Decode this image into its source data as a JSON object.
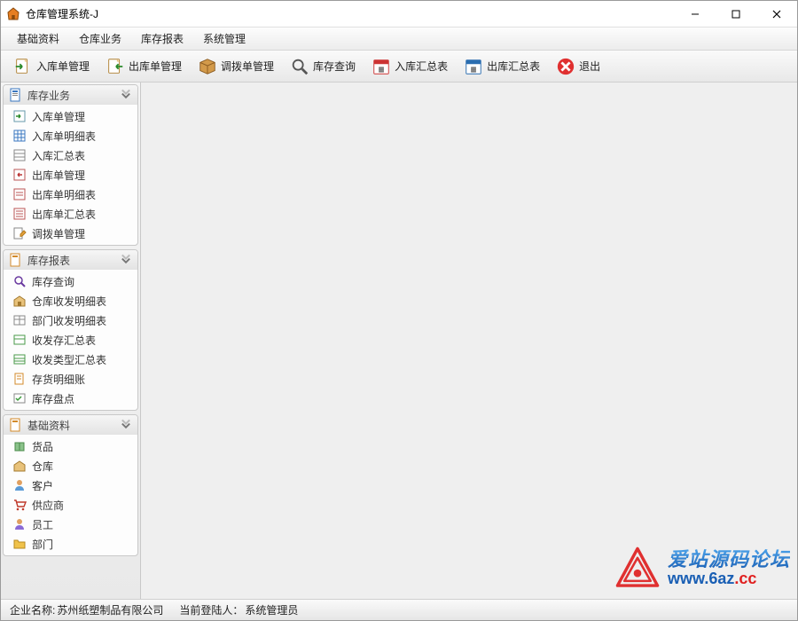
{
  "title": "仓库管理系统-J",
  "menu": [
    "基础资料",
    "仓库业务",
    "库存报表",
    "系统管理"
  ],
  "toolbar": [
    {
      "label": "入库单管理",
      "icon": "doc-arrow-in"
    },
    {
      "label": "出库单管理",
      "icon": "doc-arrow-out"
    },
    {
      "label": "调拨单管理",
      "icon": "box"
    },
    {
      "label": "库存查询",
      "icon": "magnifier"
    },
    {
      "label": "入库汇总表",
      "icon": "calendar"
    },
    {
      "label": "出库汇总表",
      "icon": "calendar"
    },
    {
      "label": "退出",
      "icon": "exit"
    }
  ],
  "panels": [
    {
      "title": "库存业务",
      "icon": "doc-blue",
      "items": [
        {
          "label": "入库单管理",
          "icon": "form-in"
        },
        {
          "label": "入库单明细表",
          "icon": "grid-blue"
        },
        {
          "label": "入库汇总表",
          "icon": "grid"
        },
        {
          "label": "出库单管理",
          "icon": "form-out"
        },
        {
          "label": "出库单明细表",
          "icon": "form-out"
        },
        {
          "label": "出库单汇总表",
          "icon": "form-out"
        },
        {
          "label": "调拨单管理",
          "icon": "doc-edit"
        }
      ]
    },
    {
      "title": "库存报表",
      "icon": "doc-orange",
      "items": [
        {
          "label": "库存查询",
          "icon": "magnifier-sm"
        },
        {
          "label": "仓库收发明细表",
          "icon": "warehouse"
        },
        {
          "label": "部门收发明细表",
          "icon": "grid-sm"
        },
        {
          "label": "收发存汇总表",
          "icon": "grid-sm"
        },
        {
          "label": "收发类型汇总表",
          "icon": "grid-sm"
        },
        {
          "label": "存货明细账",
          "icon": "doc-sm"
        },
        {
          "label": "库存盘点",
          "icon": "grid-sm"
        }
      ]
    },
    {
      "title": "基础资料",
      "icon": "doc-orange",
      "items": [
        {
          "label": "货品",
          "icon": "box-sm"
        },
        {
          "label": "仓库",
          "icon": "warehouse-sm"
        },
        {
          "label": "客户",
          "icon": "user-sm"
        },
        {
          "label": "供应商",
          "icon": "cart-sm"
        },
        {
          "label": "员工",
          "icon": "user-sm"
        },
        {
          "label": "部门",
          "icon": "folder-sm"
        }
      ]
    }
  ],
  "status": {
    "company_label": "企业名称:",
    "company_value": "苏州纸塑制品有限公司",
    "user_label": "当前登陆人：",
    "user_value": "系统管理员"
  },
  "watermark": {
    "line1": "爱站源码论坛",
    "line2_a": "www.6az",
    "line2_b": ".cc"
  }
}
